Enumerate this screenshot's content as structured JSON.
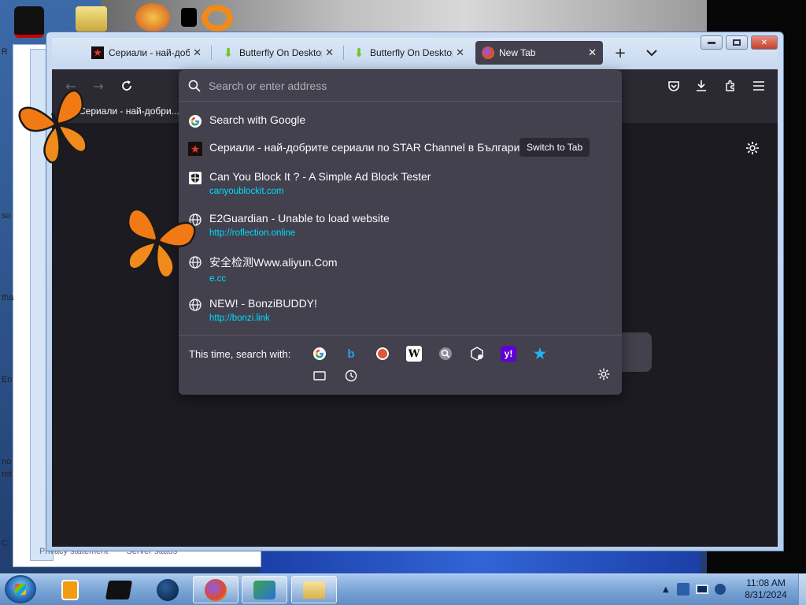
{
  "window": {
    "tabs": [
      {
        "label": "Сериали - най-добр",
        "icon": "star-channel-icon"
      },
      {
        "label": "Butterfly On Desktop",
        "icon": "download-arrow-icon"
      },
      {
        "label": "Butterfly On Desktop",
        "icon": "download-arrow-icon"
      },
      {
        "label": "New Tab",
        "icon": "firefox-icon"
      }
    ],
    "close_glyph": "✕",
    "new_tab_glyph": "+",
    "list_tabs_glyph": "⌄"
  },
  "bookmarks": {
    "item_label": "Сериали - най-добри..."
  },
  "urlbar": {
    "placeholder": "Search or enter address",
    "results": [
      {
        "title": "Search with Google",
        "url": "",
        "icon": "google-icon"
      },
      {
        "title": "Сериали - най-добрите сериали по STAR Channel в България",
        "url": "",
        "icon": "star-channel-icon",
        "action": "Switch to Tab"
      },
      {
        "title": "Can You Block It ? - A Simple Ad Block Tester",
        "url": "canyoublockit.com",
        "icon": "shield-checker-icon"
      },
      {
        "title": "E2Guardian - Unable to load website",
        "url": "http://roflection.online",
        "icon": "globe-icon"
      },
      {
        "title": "安全检测Www.aliyun.Com",
        "url": "e.cc",
        "icon": "globe-icon"
      },
      {
        "title": "NEW! - BonziBUDDY!",
        "url": "http://bonzi.link",
        "icon": "globe-icon"
      }
    ],
    "search_with_label": "This time, search with:",
    "engines": [
      "Google",
      "Bing",
      "DuckDuckGo",
      "Wikipedia",
      "Search",
      "Bookmarks Engine",
      "Yahoo",
      "Star"
    ]
  },
  "desktop": {
    "footer_links": [
      "Privacy statement",
      "Server status"
    ],
    "edge_texts": [
      "R",
      "so",
      "tha",
      "En",
      "no",
      "ret",
      "C"
    ]
  },
  "taskbar": {
    "clock_time": "11:08 AM",
    "clock_date": "8/31/2024"
  },
  "colors": {
    "popup_bg": "#42414d",
    "toolbar_bg": "#2b2a33",
    "content_bg": "#1c1b22",
    "url_color": "#00ddff"
  }
}
